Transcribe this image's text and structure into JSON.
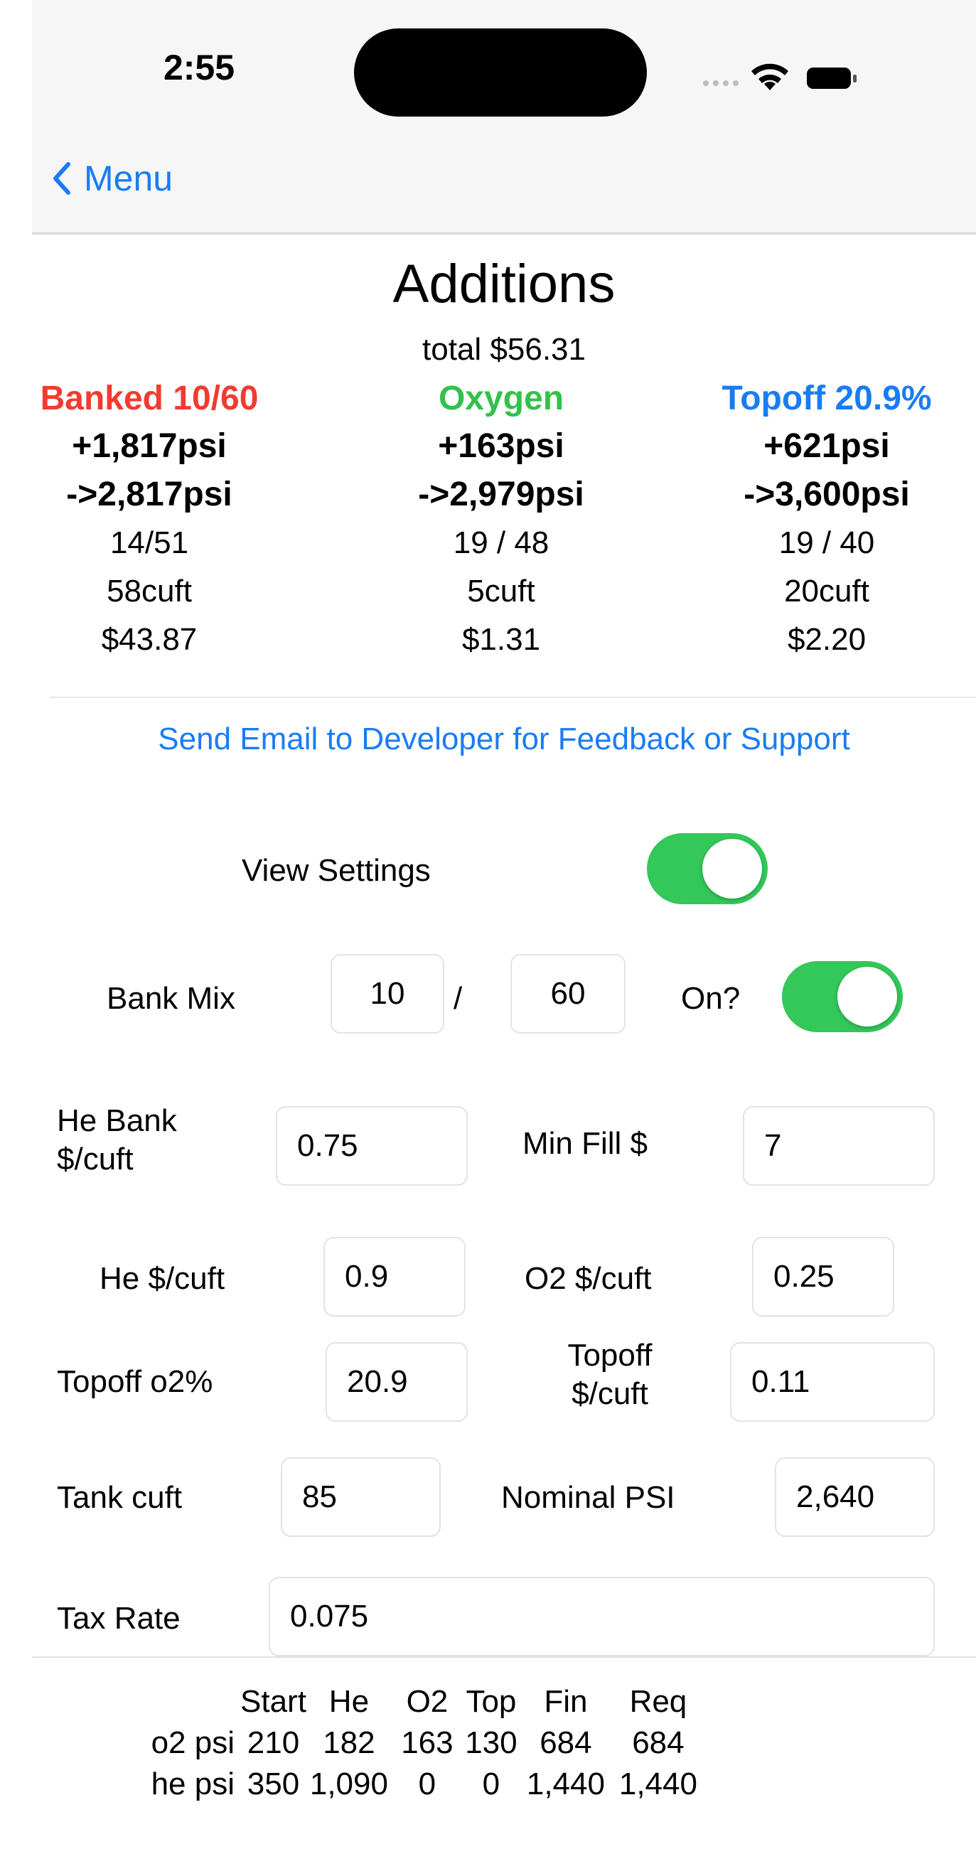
{
  "status": {
    "time": "2:55"
  },
  "nav": {
    "back_label": "Menu"
  },
  "header": {
    "title": "Additions",
    "total": "total $56.31"
  },
  "colors": {
    "red": "#f23b30",
    "green": "#33c04b",
    "blue": "#1a7cf5",
    "toggle_on": "#34c759"
  },
  "columns": [
    {
      "title": "Banked 10/60",
      "added": "+1,817psi",
      "result": "->2,817psi",
      "mix": "14/51",
      "cuft": "58cuft",
      "cost": "$43.87"
    },
    {
      "title": "Oxygen",
      "added": "+163psi",
      "result": "->2,979psi",
      "mix": "19 / 48",
      "cuft": "5cuft",
      "cost": "$1.31"
    },
    {
      "title": "Topoff 20.9%",
      "added": "+621psi",
      "result": "->3,600psi",
      "mix": "19 / 40",
      "cuft": "20cuft",
      "cost": "$2.20"
    }
  ],
  "feedback_link": "Send Email to Developer for Feedback or Support",
  "settings": {
    "view_settings_label": "View Settings",
    "bank_mix_label": "Bank Mix",
    "bank_mix_o2": "10",
    "bank_mix_sep": "/",
    "bank_mix_he": "60",
    "on_label": "On?",
    "he_bank_label_1": "He Bank",
    "he_bank_label_2": "$/cuft",
    "he_bank_value": "0.75",
    "min_fill_label": "Min Fill $",
    "min_fill_value": "7",
    "he_cuft_label": "He $/cuft",
    "he_cuft_value": "0.9",
    "o2_cuft_label": "O2 $/cuft",
    "o2_cuft_value": "0.25",
    "topoff_o2_label": "Topoff o2%",
    "topoff_o2_value": "20.9",
    "topoff_cuft_label_1": "Topoff",
    "topoff_cuft_label_2": "$/cuft",
    "topoff_cuft_value": "0.11",
    "tank_cuft_label": "Tank cuft",
    "tank_cuft_value": "85",
    "nominal_psi_label": "Nominal PSI",
    "nominal_psi_value": "2,640",
    "tax_rate_label": "Tax Rate",
    "tax_rate_value": "0.075"
  },
  "table": {
    "headers": [
      "",
      "Start",
      "He",
      "O2",
      "Top",
      "Fin",
      "Req"
    ],
    "rows": [
      [
        "o2 psi",
        "210",
        "182",
        "163",
        "130",
        "684",
        "684"
      ],
      [
        "he psi",
        "350",
        "1,090",
        "0",
        "0",
        "1,440",
        "1,440"
      ]
    ]
  }
}
